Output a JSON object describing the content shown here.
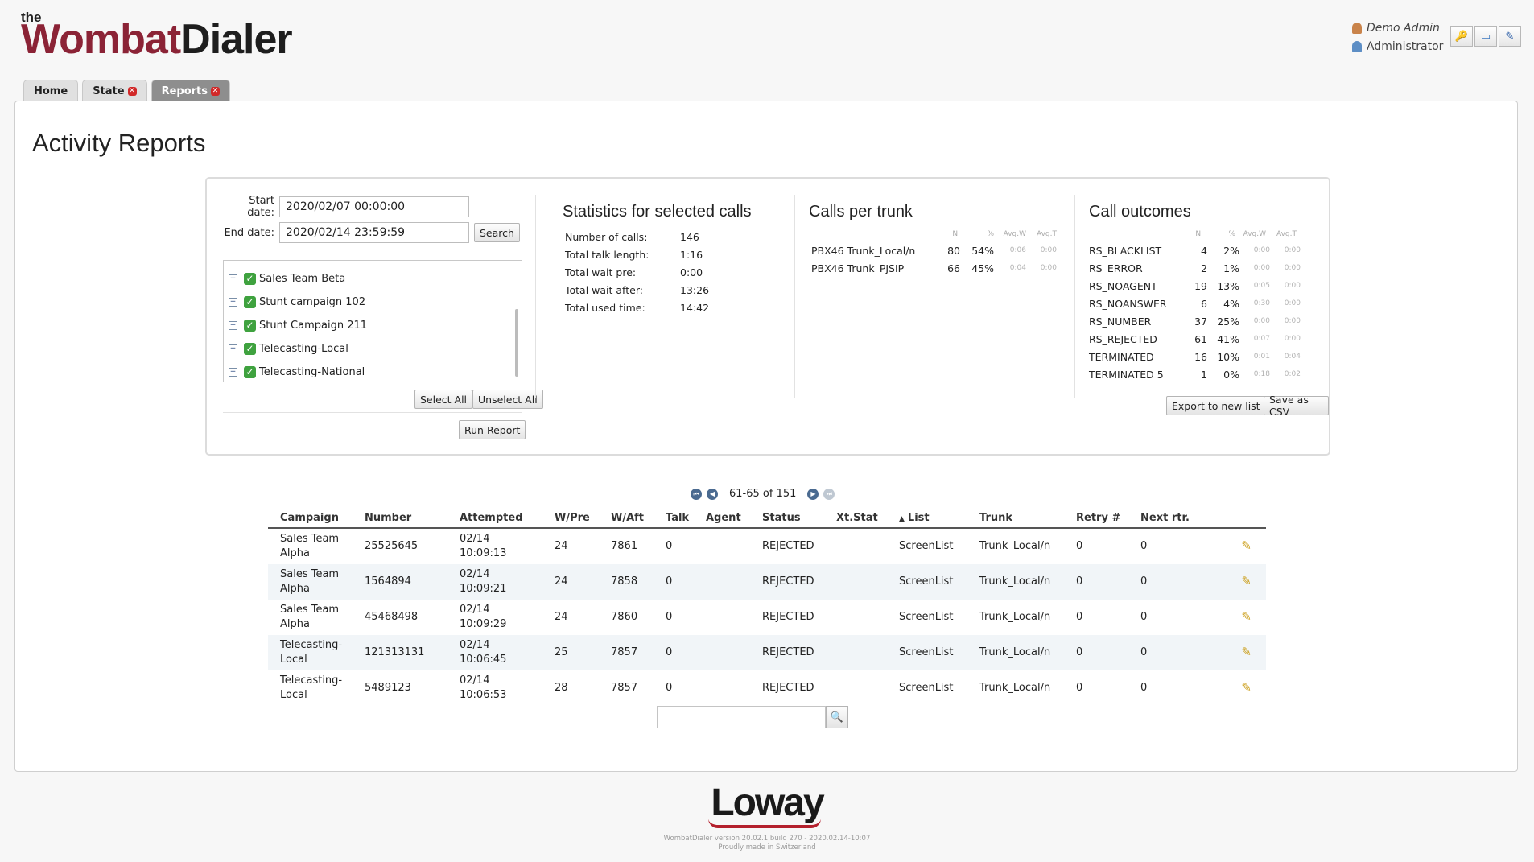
{
  "header": {
    "logo_the": "the",
    "logo_wombat": "Wombat",
    "logo_dialer": "Dialer",
    "user_name": "Demo Admin",
    "user_role": "Administrator"
  },
  "tabs": [
    {
      "label": "Home"
    },
    {
      "label": "State"
    },
    {
      "label": "Reports"
    }
  ],
  "page": {
    "title": "Activity Reports"
  },
  "filters": {
    "start_label": "Start date:",
    "start_value": "2020/02/07 00:00:00",
    "end_label": "End date:",
    "end_value": "2020/02/14 23:59:59",
    "search_label": "Search",
    "campaigns": [
      "Sales Team Beta",
      "Stunt campaign 102",
      "Stunt Campaign 211",
      "Telecasting-Local",
      "Telecasting-National"
    ],
    "select_all": "Select All",
    "unselect_all": "Unselect All",
    "run_report": "Run Report"
  },
  "stats": {
    "title": "Statistics for selected calls",
    "rows": [
      {
        "k": "Number of calls:",
        "v": "146"
      },
      {
        "k": "Total talk length:",
        "v": "1:16"
      },
      {
        "k": "Total wait pre:",
        "v": "0:00"
      },
      {
        "k": "Total wait after:",
        "v": "13:26"
      },
      {
        "k": "Total used time:",
        "v": "14:42"
      }
    ]
  },
  "trunks": {
    "title": "Calls per trunk",
    "headers": [
      "N.",
      "%",
      "Avg.W",
      "Avg.T"
    ],
    "rows": [
      {
        "name": "PBX46 Trunk_Local/n",
        "n": "80",
        "pct": "54%",
        "avgw": "0:06",
        "avgt": "0:00"
      },
      {
        "name": "PBX46 Trunk_PJSIP",
        "n": "66",
        "pct": "45%",
        "avgw": "0:04",
        "avgt": "0:00"
      }
    ]
  },
  "outcomes": {
    "title": "Call outcomes",
    "headers": [
      "N.",
      "%",
      "Avg.W",
      "Avg.T"
    ],
    "rows": [
      {
        "name": "RS_BLACKLIST",
        "n": "4",
        "pct": "2%",
        "avgw": "0:00",
        "avgt": "0:00"
      },
      {
        "name": "RS_ERROR",
        "n": "2",
        "pct": "1%",
        "avgw": "0:00",
        "avgt": "0:00"
      },
      {
        "name": "RS_NOAGENT",
        "n": "19",
        "pct": "13%",
        "avgw": "0:05",
        "avgt": "0:00"
      },
      {
        "name": "RS_NOANSWER",
        "n": "6",
        "pct": "4%",
        "avgw": "0:30",
        "avgt": "0:00"
      },
      {
        "name": "RS_NUMBER",
        "n": "37",
        "pct": "25%",
        "avgw": "0:00",
        "avgt": "0:00"
      },
      {
        "name": "RS_REJECTED",
        "n": "61",
        "pct": "41%",
        "avgw": "0:07",
        "avgt": "0:00"
      },
      {
        "name": "TERMINATED",
        "n": "16",
        "pct": "10%",
        "avgw": "0:01",
        "avgt": "0:04"
      },
      {
        "name": "TERMINATED 5",
        "n": "1",
        "pct": "0%",
        "avgw": "0:18",
        "avgt": "0:02"
      }
    ],
    "export_label": "Export to new list",
    "csv_label": "Save as CSV"
  },
  "pager": {
    "text": "61-65 of 151"
  },
  "calls": {
    "columns": [
      "Campaign",
      "Number",
      "Attempted",
      "W/Pre",
      "W/Aft",
      "Talk",
      "Agent",
      "Status",
      "Xt.Stat",
      "List",
      "Trunk",
      "Retry #",
      "Next rtr."
    ],
    "sort_marker": "▲",
    "rows": [
      {
        "campaign": "Sales Team Alpha",
        "number": "25525645",
        "date": "02/14",
        "time": "10:09:13",
        "wpre": "24",
        "waft": "7861",
        "talk": "0",
        "agent": "",
        "status": "REJECTED",
        "xtstat": "",
        "list": "ScreenList",
        "trunk": "Trunk_Local/n",
        "retry": "0",
        "next": "0"
      },
      {
        "campaign": "Sales Team Alpha",
        "number": "1564894",
        "date": "02/14",
        "time": "10:09:21",
        "wpre": "24",
        "waft": "7858",
        "talk": "0",
        "agent": "",
        "status": "REJECTED",
        "xtstat": "",
        "list": "ScreenList",
        "trunk": "Trunk_Local/n",
        "retry": "0",
        "next": "0"
      },
      {
        "campaign": "Sales Team Alpha",
        "number": "45468498",
        "date": "02/14",
        "time": "10:09:29",
        "wpre": "24",
        "waft": "7860",
        "talk": "0",
        "agent": "",
        "status": "REJECTED",
        "xtstat": "",
        "list": "ScreenList",
        "trunk": "Trunk_Local/n",
        "retry": "0",
        "next": "0"
      },
      {
        "campaign": "Telecasting-Local",
        "number": "121313131",
        "date": "02/14",
        "time": "10:06:45",
        "wpre": "25",
        "waft": "7857",
        "talk": "0",
        "agent": "",
        "status": "REJECTED",
        "xtstat": "",
        "list": "ScreenList",
        "trunk": "Trunk_Local/n",
        "retry": "0",
        "next": "0"
      },
      {
        "campaign": "Telecasting-Local",
        "number": "5489123",
        "date": "02/14",
        "time": "10:06:53",
        "wpre": "28",
        "waft": "7857",
        "talk": "0",
        "agent": "",
        "status": "REJECTED",
        "xtstat": "",
        "list": "ScreenList",
        "trunk": "Trunk_Local/n",
        "retry": "0",
        "next": "0"
      }
    ]
  },
  "footer": {
    "brand": "Loway",
    "version": "WombatDialer version 20.02.1 build 270 - 2020.02.14-10:07",
    "made": "Proudly made in Switzerland"
  }
}
